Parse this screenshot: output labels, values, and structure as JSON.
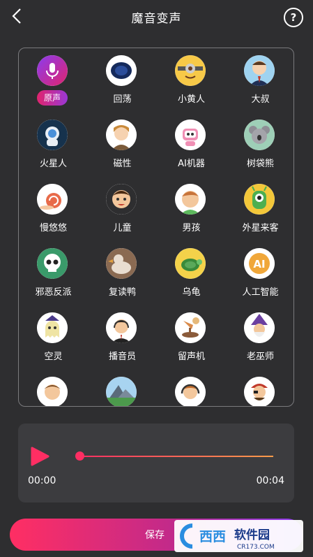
{
  "header": {
    "title": "魔音变声",
    "help": "?"
  },
  "effects": [
    {
      "label": "原声",
      "icon": "microphone-icon",
      "active": true
    },
    {
      "label": "回荡",
      "icon": "echo-icon"
    },
    {
      "label": "小黄人",
      "icon": "minion-icon"
    },
    {
      "label": "大叔",
      "icon": "uncle-icon"
    },
    {
      "label": "火星人",
      "icon": "astronaut-icon"
    },
    {
      "label": "磁性",
      "icon": "magnetic-voice-icon"
    },
    {
      "label": "AI机器",
      "icon": "robot-icon"
    },
    {
      "label": "树袋熊",
      "icon": "koala-icon"
    },
    {
      "label": "慢悠悠",
      "icon": "snail-icon"
    },
    {
      "label": "儿童",
      "icon": "child-icon"
    },
    {
      "label": "男孩",
      "icon": "boy-icon"
    },
    {
      "label": "外星来客",
      "icon": "alien-icon"
    },
    {
      "label": "邪恶反派",
      "icon": "skull-icon"
    },
    {
      "label": "复读鸭",
      "icon": "duck-icon"
    },
    {
      "label": "乌龟",
      "icon": "turtle-icon"
    },
    {
      "label": "人工智能",
      "icon": "ai-icon"
    },
    {
      "label": "空灵",
      "icon": "ghost-icon"
    },
    {
      "label": "播音员",
      "icon": "announcer-icon"
    },
    {
      "label": "留声机",
      "icon": "gramophone-icon"
    },
    {
      "label": "老巫师",
      "icon": "wizard-icon"
    },
    {
      "label": "",
      "icon": "man-icon"
    },
    {
      "label": "",
      "icon": "mountain-icon"
    },
    {
      "label": "",
      "icon": "headset-icon"
    },
    {
      "label": "",
      "icon": "pirate-icon"
    }
  ],
  "player": {
    "start_time": "00:00",
    "end_time": "00:04",
    "progress": 0.0
  },
  "save_label": "保存",
  "watermark": {
    "text": "西西软件园",
    "sub": "CR173.COM"
  },
  "colors": {
    "accent": "#ff2e63",
    "purple": "#8a3cf0",
    "background": "#2e2e30"
  }
}
